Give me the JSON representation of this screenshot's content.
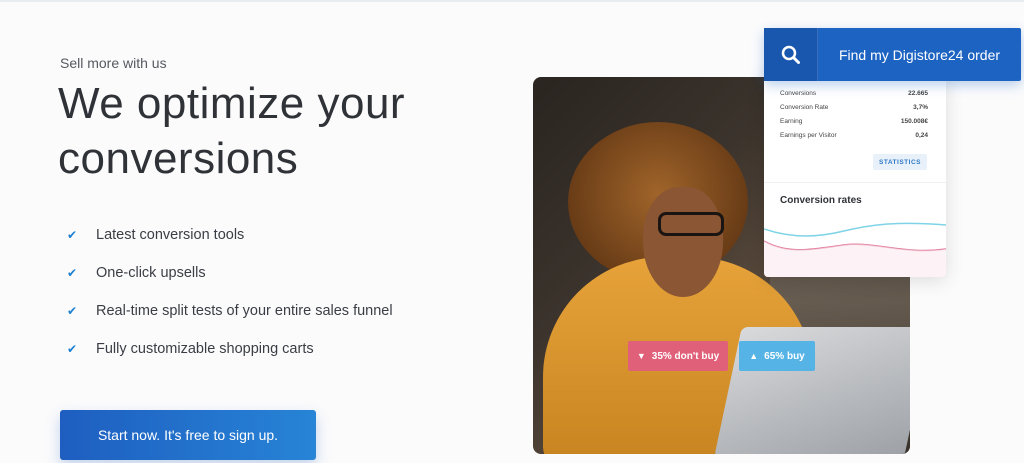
{
  "hero": {
    "eyebrow": "Sell more with us",
    "headline": "We optimize your conversions",
    "features": [
      "Latest conversion tools",
      "One-click upsells",
      "Real-time split tests of your entire sales funnel",
      "Fully customizable shopping carts"
    ],
    "cta_label": "Start now. It's free to sign up."
  },
  "find_order": {
    "label": "Find my Digistore24 order",
    "icon": "search-icon"
  },
  "stats_card": {
    "rows": [
      {
        "label": "Conversions",
        "value": "22.665"
      },
      {
        "label": "Conversion Rate",
        "value": "3,7%"
      },
      {
        "label": "Earning",
        "value": "150.008€"
      },
      {
        "label": "Earnings per Visitor",
        "value": "0,24"
      }
    ],
    "button_label": "STATISTICS",
    "chart_title": "Conversion rates"
  },
  "badges": {
    "dont_buy": "35% don't buy",
    "buy": "65% buy"
  },
  "colors": {
    "primary_blue": "#1c63c2",
    "check_blue": "#1c7fd0",
    "badge_pink": "#e0607a",
    "badge_cyan": "#55b3e6"
  }
}
